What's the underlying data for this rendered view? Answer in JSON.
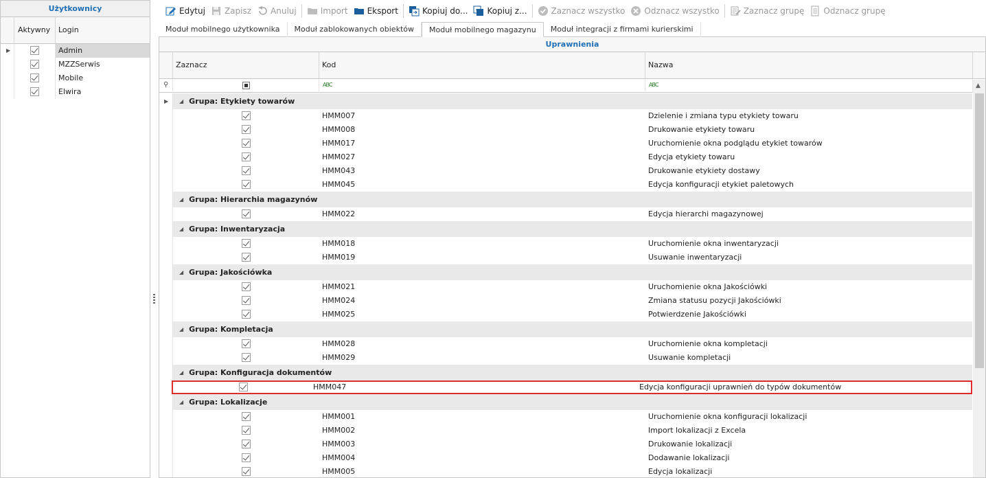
{
  "users_panel": {
    "title": "Użytkownicy",
    "columns": {
      "active": "Aktywny",
      "login": "Login"
    },
    "users": [
      {
        "login": "Admin",
        "active": true
      },
      {
        "login": "MZZSerwis",
        "active": true
      },
      {
        "login": "Mobile",
        "active": true
      },
      {
        "login": "Elwira",
        "active": true
      }
    ]
  },
  "toolbar": {
    "edit": "Edytuj",
    "save": "Zapisz",
    "cancel": "Anuluj",
    "import": "Import",
    "export": "Eksport",
    "copy_to": "Kopiuj do...",
    "copy_from": "Kopiuj z...",
    "select_all": "Zaznacz wszystko",
    "deselect_all": "Odznacz wszystko",
    "select_group": "Zaznacz grupę",
    "deselect_group": "Odznacz grupę"
  },
  "tabs": [
    "Moduł mobilnego użytkownika",
    "Moduł zablokowanych obiektów",
    "Moduł mobilnego magazynu",
    "Moduł integracji z firmami kurierskimi"
  ],
  "active_tab": 2,
  "grid": {
    "title": "Uprawnienia",
    "columns": {
      "select": "Zaznacz",
      "code": "Kod",
      "name": "Nazwa"
    },
    "filter_symbol": "ABC"
  },
  "groups": [
    {
      "label": "Grupa: Etykiety towarów",
      "items": [
        {
          "code": "HMM007",
          "name": "Dzielenie i zmiana typu etykiety towaru"
        },
        {
          "code": "HMM008",
          "name": "Drukowanie etykiety towaru"
        },
        {
          "code": "HMM017",
          "name": "Uruchomienie okna podglądu etykiet towarów"
        },
        {
          "code": "HMM027",
          "name": "Edycja etykiety towaru"
        },
        {
          "code": "HMM043",
          "name": "Drukowanie etykiety dostawy"
        },
        {
          "code": "HMM045",
          "name": "Edycja konfiguracji etykiet paletowych"
        }
      ]
    },
    {
      "label": "Grupa: Hierarchia magazynów",
      "items": [
        {
          "code": "HMM022",
          "name": "Edycja hierarchi magazynowej"
        }
      ]
    },
    {
      "label": "Grupa: Inwentaryzacja",
      "items": [
        {
          "code": "HMM018",
          "name": "Uruchomienie okna inwentaryzacji"
        },
        {
          "code": "HMM019",
          "name": "Usuwanie inwentaryzacji"
        }
      ]
    },
    {
      "label": "Grupa: Jakościówka",
      "items": [
        {
          "code": "HMM021",
          "name": "Uruchomienie okna Jakościówki"
        },
        {
          "code": "HMM024",
          "name": "Zmiana statusu pozycji Jakościówki"
        },
        {
          "code": "HMM025",
          "name": "Potwierdzenie Jakościówki"
        }
      ]
    },
    {
      "label": "Grupa: Kompletacja",
      "items": [
        {
          "code": "HMM028",
          "name": "Uruchomienie okna kompletacji"
        },
        {
          "code": "HMM029",
          "name": "Usuwanie kompletacji"
        }
      ]
    },
    {
      "label": "Grupa: Konfiguracja dokumentów",
      "items": [
        {
          "code": "HMM047",
          "name": "Edycja konfiguracji uprawnień do typów dokumentów",
          "highlighted": true
        }
      ]
    },
    {
      "label": "Grupa: Lokalizacje",
      "items": [
        {
          "code": "HMM001",
          "name": "Uruchomienie okna konfiguracji lokalizacji"
        },
        {
          "code": "HMM002",
          "name": "Import lokalizacji z Excela"
        },
        {
          "code": "HMM003",
          "name": "Drukowanie lokalizacji"
        },
        {
          "code": "HMM004",
          "name": "Dodawanie lokalizacji"
        },
        {
          "code": "HMM005",
          "name": "Edycja lokalizacji"
        }
      ]
    }
  ],
  "colors": {
    "accent": "#1f6fb5",
    "highlight": "#e02b2b"
  }
}
